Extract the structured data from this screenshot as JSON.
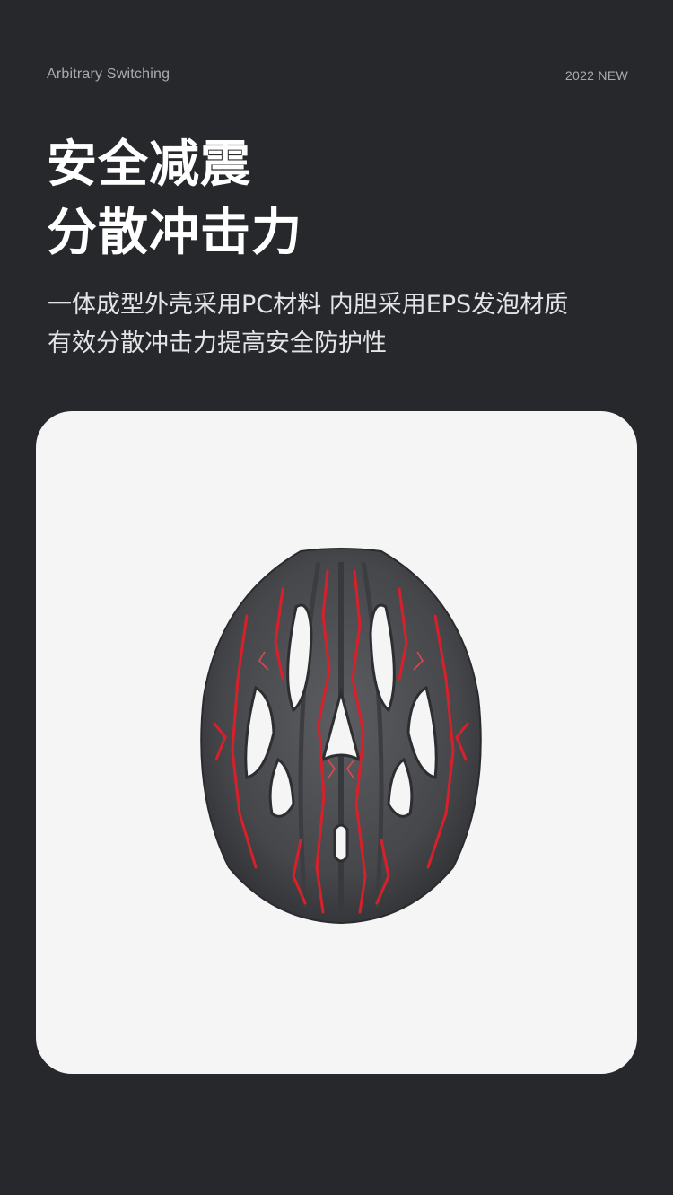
{
  "header": {
    "tagline": "Arbitrary Switching",
    "badge": "2022  NEW"
  },
  "headline": {
    "line1": "安全减震",
    "line2": "分散冲击力"
  },
  "description": {
    "line1": "一体成型外壳采用PC材料 内胆采用EPS发泡材质",
    "line2": "有效分散冲击力提高安全防护性"
  },
  "product": {
    "image_name": "helmet-top-view",
    "colors": {
      "shell": "#4a4b4e",
      "accent": "#d9202a",
      "vent": "#f5f5f5"
    }
  }
}
